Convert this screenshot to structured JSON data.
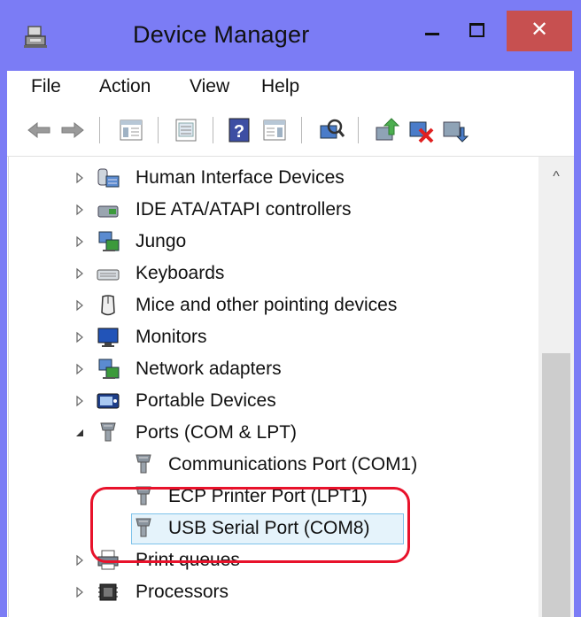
{
  "window": {
    "title": "Device Manager",
    "close_glyph": "✕"
  },
  "menu": [
    "File",
    "Action",
    "View",
    "Help"
  ],
  "toolbar": {
    "icons": [
      "back-arrow-icon",
      "forward-arrow-icon",
      "show-hide-console-tree-icon",
      "properties-icon",
      "help-icon",
      "action-pane-icon",
      "scan-hardware-icon",
      "update-driver-icon",
      "disable-device-icon",
      "uninstall-device-icon"
    ]
  },
  "tree": {
    "items": [
      {
        "label": "Human Interface Devices",
        "icon": "hid-icon",
        "level": 1,
        "expander": "collapsed"
      },
      {
        "label": "IDE ATA/ATAPI controllers",
        "icon": "ide-controller-icon",
        "level": 1,
        "expander": "collapsed"
      },
      {
        "label": "Jungo",
        "icon": "network-device-icon",
        "level": 1,
        "expander": "collapsed"
      },
      {
        "label": "Keyboards",
        "icon": "keyboard-icon",
        "level": 1,
        "expander": "collapsed"
      },
      {
        "label": "Mice and other pointing devices",
        "icon": "mouse-icon",
        "level": 1,
        "expander": "collapsed"
      },
      {
        "label": "Monitors",
        "icon": "monitor-icon",
        "level": 1,
        "expander": "collapsed"
      },
      {
        "label": "Network adapters",
        "icon": "network-adapter-icon",
        "level": 1,
        "expander": "collapsed"
      },
      {
        "label": "Portable Devices",
        "icon": "portable-device-icon",
        "level": 1,
        "expander": "collapsed"
      },
      {
        "label": "Ports (COM & LPT)",
        "icon": "port-icon",
        "level": 1,
        "expander": "expanded"
      },
      {
        "label": "Communications Port (COM1)",
        "icon": "port-icon",
        "level": 2,
        "expander": "none"
      },
      {
        "label": "ECP Printer Port (LPT1)",
        "icon": "port-icon",
        "level": 2,
        "expander": "none"
      },
      {
        "label": "USB Serial Port (COM8)",
        "icon": "port-icon",
        "level": 2,
        "expander": "none",
        "selected": true
      },
      {
        "label": "Print queues",
        "icon": "printer-icon",
        "level": 1,
        "expander": "collapsed"
      },
      {
        "label": "Processors",
        "icon": "processor-icon",
        "level": 1,
        "expander": "collapsed"
      }
    ]
  },
  "scrollbar": {
    "up_glyph": "^"
  }
}
